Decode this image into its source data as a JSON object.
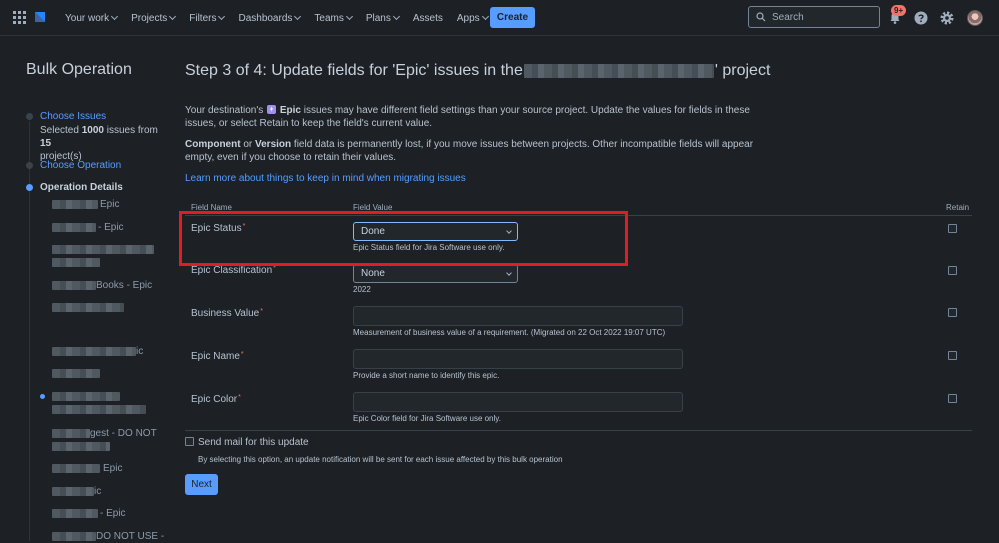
{
  "nav": {
    "items": [
      {
        "label": "Your work",
        "dropdown": true
      },
      {
        "label": "Projects",
        "dropdown": true
      },
      {
        "label": "Filters",
        "dropdown": true
      },
      {
        "label": "Dashboards",
        "dropdown": true
      },
      {
        "label": "Teams",
        "dropdown": true
      },
      {
        "label": "Plans",
        "dropdown": true
      },
      {
        "label": "Assets",
        "dropdown": false
      },
      {
        "label": "Apps",
        "dropdown": true
      }
    ],
    "create_label": "Create",
    "search_placeholder": "Search",
    "notification_badge": "9+",
    "icons": [
      "app-switcher-icon",
      "jira-logo-icon",
      "search-icon",
      "bell-icon",
      "help-icon",
      "gear-icon"
    ]
  },
  "sidebar": {
    "title": "Bulk Operation",
    "step1": {
      "link": "Choose Issues",
      "desc_prefix": "Selected ",
      "desc_count": "1000",
      "desc_mid": " issues from ",
      "desc_projects": "15",
      "desc_suffix": "project(s)"
    },
    "step2": {
      "link": "Choose Operation"
    },
    "step3": {
      "label": "Operation Details"
    },
    "sub_items": [
      {
        "text": "Epic"
      },
      {
        "text": "- Epic"
      },
      {
        "text": ""
      },
      {
        "text": "Books - Epic"
      },
      {
        "text": ""
      },
      {
        "text": "ic"
      },
      {
        "text": ""
      },
      {
        "text": ""
      },
      {
        "text": "gest - DO NOT"
      },
      {
        "text": "Epic"
      },
      {
        "text": "ic"
      },
      {
        "text": "- Epic"
      },
      {
        "text": "DO NOT USE -"
      }
    ]
  },
  "main": {
    "title_prefix": "Step 3 of 4: Update fields for 'Epic' issues in the ",
    "title_suffix": "' project",
    "para1_a": "Your destination's ",
    "para1_epic": "Epic",
    "para1_b": " issues may have different field settings than your source project. Update the values for fields in these issues, or select Retain to keep the field's current value.",
    "para2_component": "Component",
    "para2_or": " or ",
    "para2_version": "Version",
    "para2_rest": " field data is permanently lost, if you move issues between projects. Other incompatible fields will appear empty, even if you choose to retain their values.",
    "learn_more": "Learn more about things to keep in mind when migrating issues",
    "table": {
      "col_field_name": "Field Name",
      "col_field_value": "Field Value",
      "col_retain": "Retain"
    },
    "fields": {
      "epic_status": {
        "label": "Epic Status",
        "value": "Done",
        "help": "Epic Status field for Jira Software use only."
      },
      "epic_classification": {
        "label": "Epic Classification",
        "value": "None",
        "help": "2022"
      },
      "business_value": {
        "label": "Business Value",
        "value": "",
        "help": "Measurement of business value of a requirement. (Migrated on 22 Oct 2022 19:07 UTC)"
      },
      "epic_name": {
        "label": "Epic Name",
        "value": "",
        "help": "Provide a short name to identify this epic."
      },
      "epic_color": {
        "label": "Epic Color",
        "value": "",
        "help": "Epic Color field for Jira Software use only."
      }
    },
    "required_marker": "*",
    "send_mail_label": "Send mail for this update",
    "send_mail_help": "By selecting this option, an update notification will be sent for each issue affected by this bulk operation",
    "next_label": "Next"
  },
  "colors": {
    "background": "#1d2125",
    "accent": "#579dff",
    "highlight_box": "#e31b23",
    "required": "#f87168",
    "epic_purple": "#9f8fef"
  }
}
